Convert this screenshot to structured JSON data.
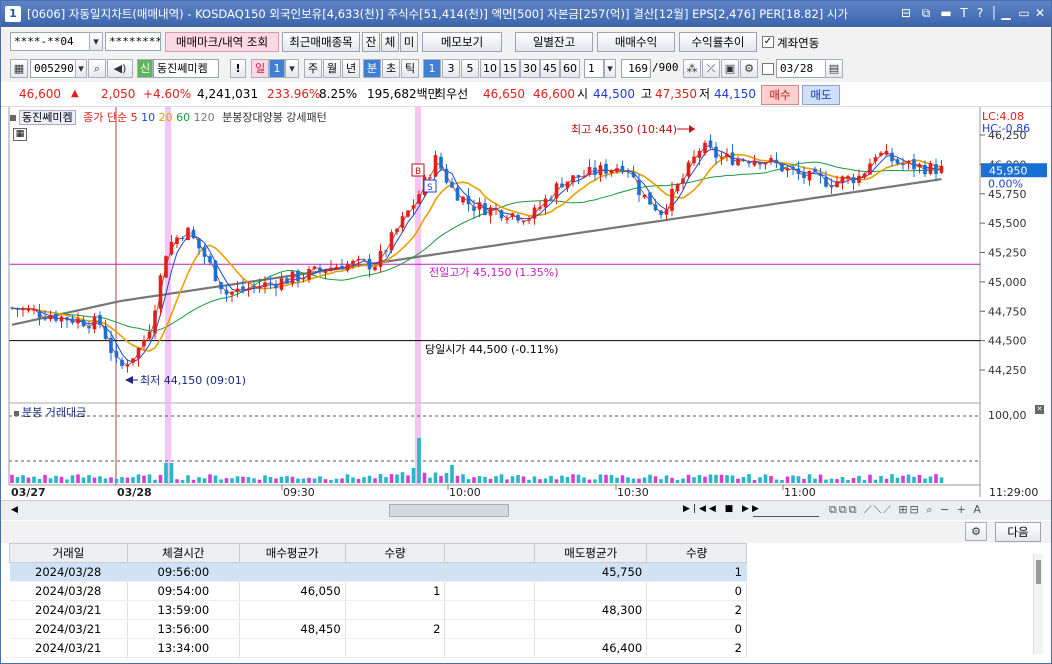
{
  "window": {
    "title": "[0606] 자동일지차트(매매내역) - KOSDAQ150 외국인보유[4,633(천)] 주식수[51,414(천)] 액면[500] 자본금[257(억)] 결산[12월] EPS[2,476] PER[18.82] 시가",
    "number_badge": "1",
    "controls": [
      "⊟",
      "⧉",
      "▬",
      "T",
      "?",
      "│",
      "▭",
      "✕"
    ]
  },
  "toolbar1": {
    "account": "****-**04",
    "password": "*********",
    "buttons": [
      "매매마크/내역 조회",
      "최근매매종목",
      "잔",
      "체",
      "미",
      "메모보기"
    ],
    "right_buttons": [
      "일별잔고",
      "매매수익",
      "수익률추이"
    ],
    "checkbox_label": "계좌연동",
    "checkbox_checked": "✓"
  },
  "toolbar2": {
    "code": "005290",
    "stock_name": "동진쎄미켐",
    "badge_sin": "신",
    "exclaim": "!",
    "periods": [
      "일",
      "1",
      "주",
      "월",
      "년",
      "분",
      "초",
      "틱"
    ],
    "intervals": [
      "1",
      "3",
      "5",
      "10",
      "15",
      "30",
      "45",
      "60"
    ],
    "count_select": "1",
    "range": "169",
    "range_total": "/900",
    "date": "03/28"
  },
  "pricebar": {
    "price": "46,600",
    "arrow": "▲",
    "change": "2,050",
    "change_pct": "+4.60%",
    "volume": "4,241,031",
    "vol_ratio": "233.96%",
    "turnover_pct": "8.25%",
    "amount": "195,682백만",
    "best_label": "최우선",
    "best_ask": "46,650",
    "best_bid": "46,600",
    "open_label": "시",
    "open": "44,500",
    "high_label": "고",
    "high": "47,350",
    "low_label": "저",
    "low": "44,150",
    "buy_btn": "매수",
    "sell_btn": "매도"
  },
  "chart": {
    "legend_name": "동진쎄미켐",
    "legend_ma_label": "종가 단순",
    "ma_periods": [
      "5",
      "10",
      "20",
      "60",
      "120"
    ],
    "pattern_label": "분봉장대양봉 강세패턴",
    "lc": "LC:4.08",
    "hc": "HC:-0.86",
    "current_price_tag": "45,950",
    "zero_pct": "0.00%",
    "y_ticks": [
      "46,250",
      "46,000",
      "45,750",
      "45,500",
      "45,250",
      "45,000",
      "44,750",
      "44,500",
      "44,250"
    ],
    "high_annotation": "최고 46,350 (10:44)",
    "low_annotation": "최저 44,150 (09:01)",
    "prev_high_line": "전일고가 45,150 (1.35%)",
    "open_line": "당일시가 44,500 (-0.11%)",
    "marker_b": "B",
    "marker_s": "S",
    "volume_title": "분봉 거래대금",
    "volume_tick": "100,00",
    "x_labels": [
      "03/27",
      "03/28",
      "09:30",
      "10:00",
      "10:30",
      "11:00",
      "11:29:00"
    ],
    "colors": {
      "up": "#e0201a",
      "down": "#1a6fd4",
      "ma5": "#e0201a",
      "ma10": "#2244cc",
      "ma20": "#e8a000",
      "ma60": "#1a9a3a",
      "ma120": "#777777",
      "highlight": "#f3b7f3"
    }
  },
  "bottom_controls": {
    "next_button": "다음"
  },
  "trades": {
    "headers": [
      "거래일",
      "체결시간",
      "매수평균가",
      "수량",
      "",
      "매도평균가",
      "수량"
    ],
    "rows": [
      [
        "2024/03/28",
        "09:56:00",
        "",
        "",
        "",
        "45,750",
        "1"
      ],
      [
        "2024/03/28",
        "09:54:00",
        "46,050",
        "1",
        "",
        "",
        "0"
      ],
      [
        "2024/03/21",
        "13:59:00",
        "",
        "",
        "",
        "48,300",
        "2"
      ],
      [
        "2024/03/21",
        "13:56:00",
        "48,450",
        "2",
        "",
        "",
        "0"
      ],
      [
        "2024/03/21",
        "13:34:00",
        "",
        "",
        "",
        "46,400",
        "2"
      ]
    ]
  }
}
